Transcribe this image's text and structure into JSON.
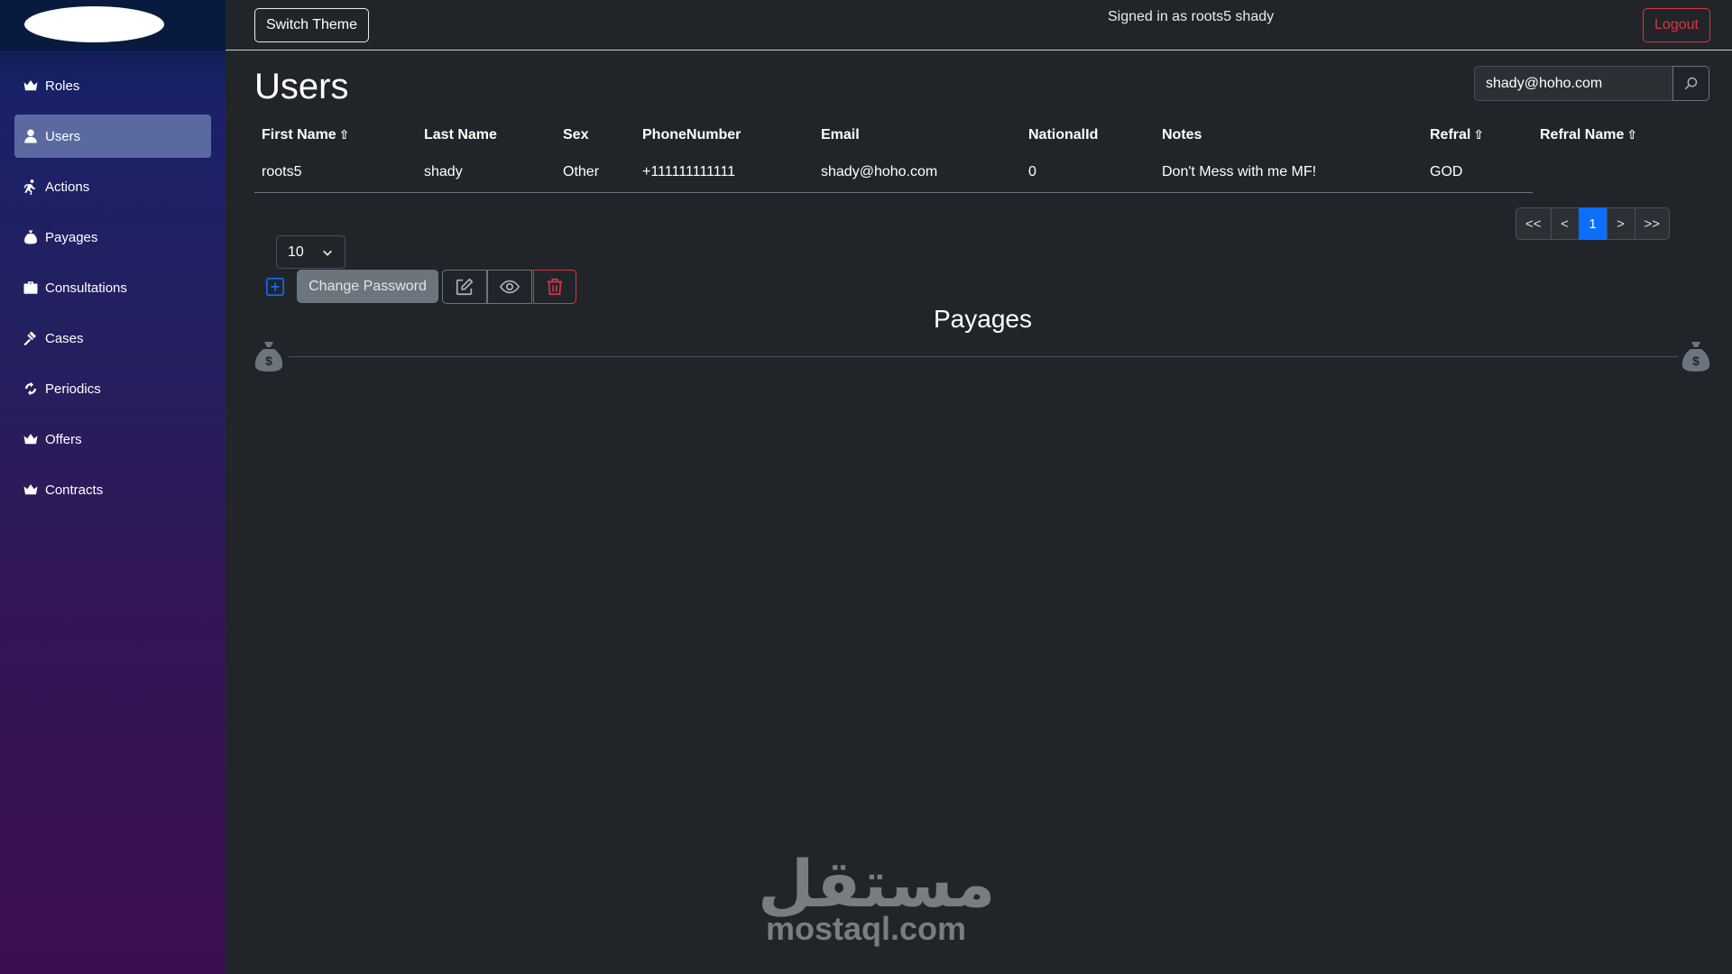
{
  "sidebar": {
    "items": [
      {
        "label": "Roles",
        "icon": "crown-icon"
      },
      {
        "label": "Users",
        "icon": "user-icon",
        "active": true
      },
      {
        "label": "Actions",
        "icon": "running-icon"
      },
      {
        "label": "Payages",
        "icon": "money-bag-icon"
      },
      {
        "label": "Consultations",
        "icon": "briefcase-icon"
      },
      {
        "label": "Cases",
        "icon": "gavel-icon"
      },
      {
        "label": "Periodics",
        "icon": "recycle-icon"
      },
      {
        "label": "Offers",
        "icon": "crown-icon"
      },
      {
        "label": "Contracts",
        "icon": "crown-icon"
      }
    ]
  },
  "topbar": {
    "switch_theme_label": "Switch Theme",
    "signed_in_text": "Signed in as roots5 shady",
    "logout_label": "Logout"
  },
  "main": {
    "title": "Users",
    "search": {
      "value": "shady@hoho.com"
    },
    "table": {
      "columns": [
        "First Name",
        "Last Name",
        "Sex",
        "PhoneNumber",
        "Email",
        "NationalId",
        "Notes",
        "Refral",
        "Refral Name"
      ],
      "sort_arrow": "⇧",
      "rows": [
        [
          "roots5",
          "shady",
          "Other",
          "+111111111111",
          "shady@hoho.com",
          "0",
          "Don't Mess with me MF!",
          "GOD",
          ""
        ]
      ]
    },
    "pagination": {
      "first": "<<",
      "prev": "<",
      "current": "1",
      "next": ">",
      "last": ">>"
    },
    "page_size": "10",
    "change_password_label": "Change Password",
    "section_title": "Payages"
  },
  "watermark": {
    "arabic": "مستقل",
    "latin": "mostaql.com"
  },
  "colors": {
    "accent": "#0d6efd",
    "danger": "#dc3545",
    "background": "#212529",
    "sidebar_active": "#5a6aa1"
  }
}
